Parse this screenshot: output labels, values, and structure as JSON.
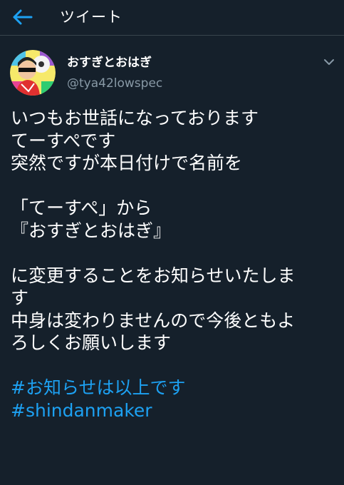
{
  "header": {
    "title": "ツイート"
  },
  "tweet": {
    "display_name": "おすぎとおはぎ",
    "handle": "@tya42lowspec",
    "lines": [
      "いつもお世話になっております",
      "てーすぺです",
      "突然ですが本日付けで名前を",
      "",
      "「てーすぺ」から",
      "『おすぎとおはぎ』",
      "",
      "に変更することをお知らせいたしま",
      "す",
      "中身は変わりませんので今後ともよ",
      "ろしくお願いします",
      ""
    ],
    "hashtags": [
      "#お知らせは以上です",
      "#shindanmaker"
    ]
  },
  "icons": {
    "back": "arrow-left-icon",
    "caret": "chevron-down-icon"
  },
  "colors": {
    "background": "#15202b",
    "accent": "#1da1f2",
    "secondary_text": "#8899a6"
  }
}
